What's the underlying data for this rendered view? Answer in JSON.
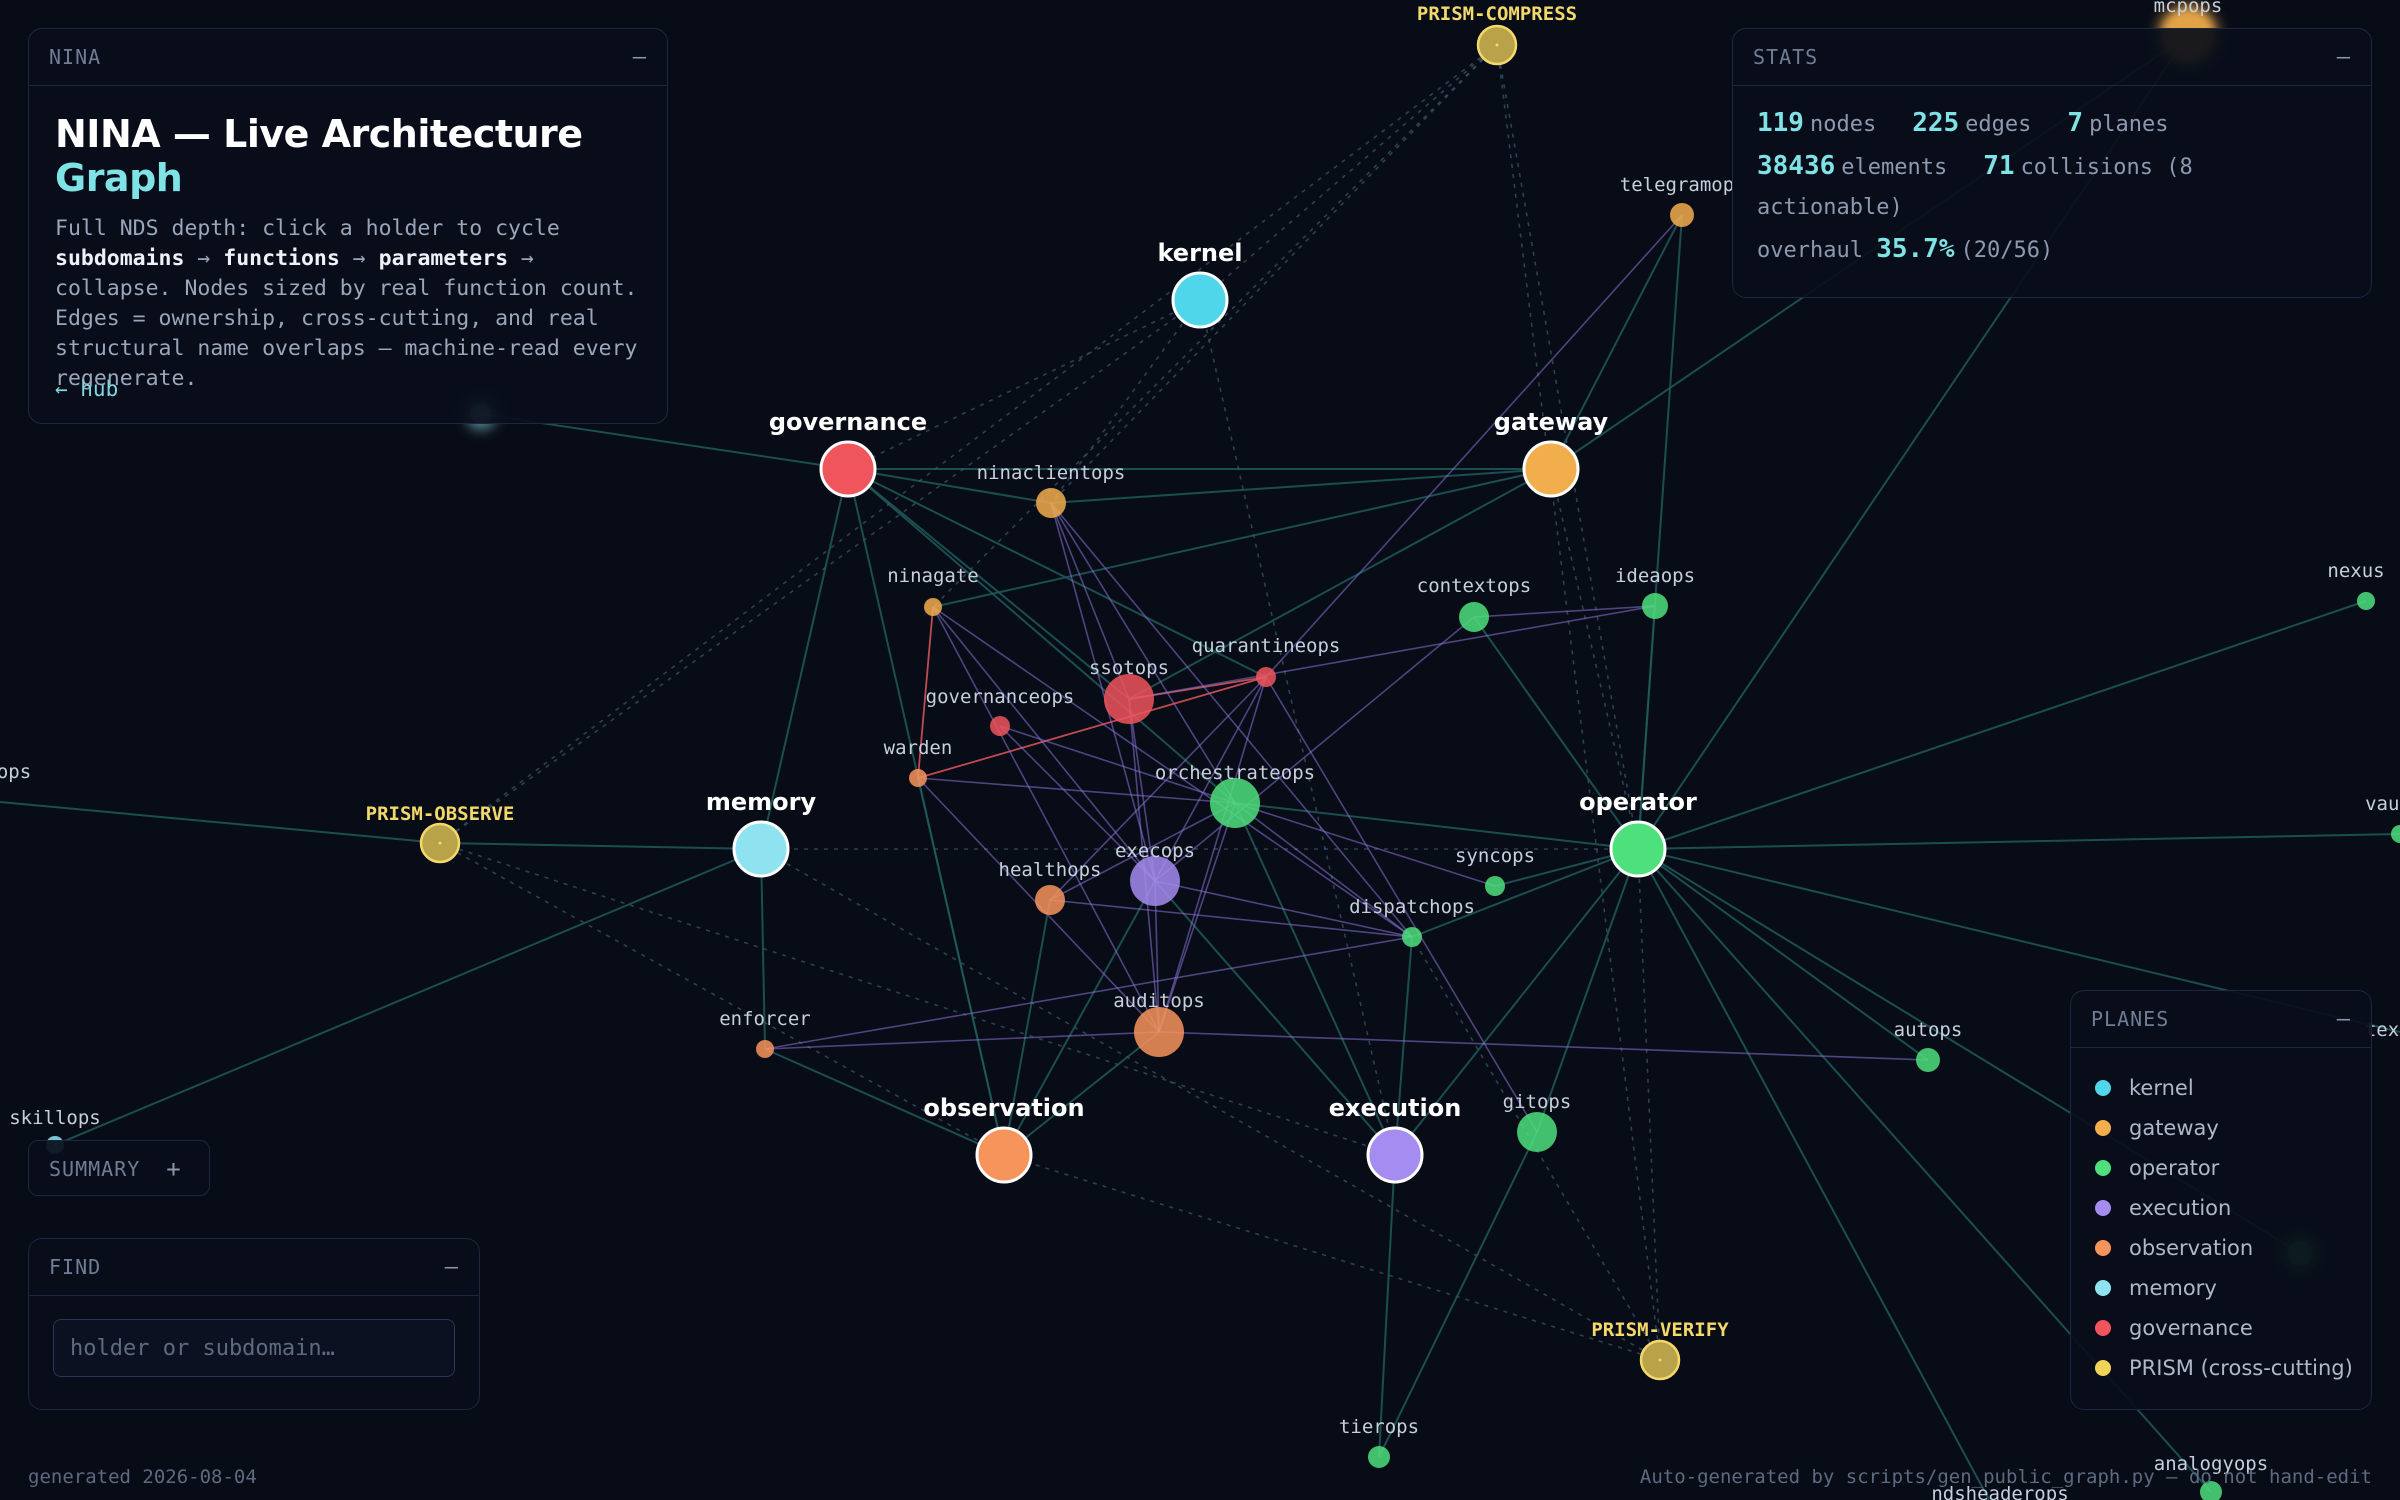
{
  "colors": {
    "background": "#080c16",
    "kernel": "#4fd6ea",
    "gateway": "#f2ad4c",
    "operator": "#4ee07c",
    "execution": "#a58cf0",
    "observation": "#f7945c",
    "memory": "#8fe3f0",
    "governance": "#f0555d",
    "prism": "#f0d45a",
    "edge_teal": "#1f5a5a",
    "edge_purple": "#8b72d8",
    "edge_red": "#e0565e"
  },
  "info_panel": {
    "header": "NINA",
    "title_main": "NINA — Live Architecture",
    "title_accent": "Graph",
    "desc_1": "Full NDS depth: click a holder to cycle",
    "desc_b1": "subdomains",
    "desc_arrow1": " → ",
    "desc_b2": "functions",
    "desc_arrow2": " → ",
    "desc_b3": "parameters",
    "desc_arrow3": " →",
    "desc_2": "collapse. Nodes sized by real function count. Edges = ownership, cross-cutting, and real structural name overlaps — machine-read every regenerate.",
    "hub_link": "← hub"
  },
  "stats_panel": {
    "header": "STATS",
    "nodes": "119",
    "nodes_label": "nodes",
    "edges": "225",
    "edges_label": "edges",
    "planes": "7",
    "planes_label": "planes",
    "elements": "38436",
    "elements_label": "elements",
    "collisions": "71",
    "collisions_label": "collisions (8 actionable)",
    "overhaul_label": "overhaul",
    "overhaul": "35.7%",
    "overhaul_ratio": "(20/56)"
  },
  "planes_panel": {
    "header": "PLANES",
    "items": [
      {
        "label": "kernel",
        "color": "#4fd6ea"
      },
      {
        "label": "gateway",
        "color": "#f2ad4c"
      },
      {
        "label": "operator",
        "color": "#4ee07c"
      },
      {
        "label": "execution",
        "color": "#a58cf0"
      },
      {
        "label": "observation",
        "color": "#f7945c"
      },
      {
        "label": "memory",
        "color": "#8fe3f0"
      },
      {
        "label": "governance",
        "color": "#f0555d"
      },
      {
        "label": "PRISM (cross-cutting)",
        "color": "#f0d45a"
      }
    ]
  },
  "summary_panel": {
    "header": "SUMMARY",
    "toggle": "+"
  },
  "find_panel": {
    "header": "FIND",
    "placeholder": "holder or subdomain…"
  },
  "footer": {
    "left": "generated 2026-08-04",
    "right": "Auto-generated by scripts/gen_public_graph.py — do not hand-edit"
  },
  "minimize_symbol": "–",
  "graph": {
    "nodes": [
      {
        "id": "kernel",
        "label": "kernel",
        "kind": "plane",
        "plane": "kernel"
      },
      {
        "id": "governance",
        "label": "governance",
        "kind": "plane",
        "plane": "governance"
      },
      {
        "id": "gateway",
        "label": "gateway",
        "kind": "plane",
        "plane": "gateway"
      },
      {
        "id": "memory",
        "label": "memory",
        "kind": "plane",
        "plane": "memory"
      },
      {
        "id": "operator",
        "label": "operator",
        "kind": "plane",
        "plane": "operator"
      },
      {
        "id": "observation",
        "label": "observation",
        "kind": "plane",
        "plane": "observation"
      },
      {
        "id": "execution",
        "label": "execution",
        "kind": "plane",
        "plane": "execution"
      },
      {
        "id": "prism-compress",
        "label": "PRISM-COMPRESS",
        "kind": "prism",
        "plane": "prism"
      },
      {
        "id": "prism-observe",
        "label": "PRISM-OBSERVE",
        "kind": "prism",
        "plane": "prism"
      },
      {
        "id": "prism-verify",
        "label": "PRISM-VERIFY",
        "kind": "prism",
        "plane": "prism"
      },
      {
        "id": "ninaclientops",
        "label": "ninaclientops",
        "kind": "holder",
        "plane": "gateway"
      },
      {
        "id": "ninagate",
        "label": "ninagate",
        "kind": "holder",
        "plane": "gateway"
      },
      {
        "id": "telegramops",
        "label": "telegramop",
        "kind": "holder",
        "plane": "gateway"
      },
      {
        "id": "mcpops",
        "label": "mcpops",
        "kind": "holder",
        "plane": "gateway"
      },
      {
        "id": "contextops",
        "label": "contextops",
        "kind": "holder",
        "plane": "operator"
      },
      {
        "id": "ideaops",
        "label": "ideaops",
        "kind": "holder",
        "plane": "operator"
      },
      {
        "id": "quarantineops",
        "label": "quarantineops",
        "kind": "holder",
        "plane": "governance"
      },
      {
        "id": "ssotops",
        "label": "ssotops",
        "kind": "holder",
        "plane": "governance"
      },
      {
        "id": "governanceops",
        "label": "governanceops",
        "kind": "holder",
        "plane": "governance"
      },
      {
        "id": "warden",
        "label": "warden",
        "kind": "holder",
        "plane": "observation"
      },
      {
        "id": "orchestrateops",
        "label": "orchestrateops",
        "kind": "holder",
        "plane": "operator"
      },
      {
        "id": "execops",
        "label": "execops",
        "kind": "holder",
        "plane": "execution"
      },
      {
        "id": "healthops",
        "label": "healthops",
        "kind": "holder",
        "plane": "observation"
      },
      {
        "id": "syncops",
        "label": "syncops",
        "kind": "holder",
        "plane": "operator"
      },
      {
        "id": "dispatchops",
        "label": "dispatchops",
        "kind": "holder",
        "plane": "operator"
      },
      {
        "id": "auditops",
        "label": "auditops",
        "kind": "holder",
        "plane": "observation"
      },
      {
        "id": "enforcer",
        "label": "enforcer",
        "kind": "holder",
        "plane": "observation"
      },
      {
        "id": "autops",
        "label": "autops",
        "kind": "holder",
        "plane": "operator"
      },
      {
        "id": "gitops",
        "label": "gitops",
        "kind": "holder",
        "plane": "operator"
      },
      {
        "id": "tierops",
        "label": "tierops",
        "kind": "holder",
        "plane": "operator"
      },
      {
        "id": "nexus",
        "label": "nexus",
        "kind": "holder",
        "plane": "operator"
      },
      {
        "id": "vault",
        "label": "vaul",
        "kind": "holder",
        "plane": "operator"
      },
      {
        "id": "skillops",
        "label": "skillops",
        "kind": "holder",
        "plane": "memory"
      },
      {
        "id": "ops-left",
        "label": "ops",
        "kind": "holder",
        "plane": "operator"
      },
      {
        "id": "analogyops",
        "label": "analogyops",
        "kind": "holder",
        "plane": "operator"
      },
      {
        "id": "ndsheaderops",
        "label": "ndsheaderops",
        "kind": "holder",
        "plane": "operator"
      },
      {
        "id": "contex-right",
        "label": "tex",
        "kind": "holder",
        "plane": "operator"
      },
      {
        "id": "blurred-memory",
        "label": "",
        "kind": "holder",
        "plane": "memory"
      },
      {
        "id": "blurred-operator",
        "label": "",
        "kind": "holder",
        "plane": "operator"
      }
    ],
    "edges": [
      {
        "from": "governance",
        "to": "ninaclientops",
        "style": "teal"
      },
      {
        "from": "governance",
        "to": "gateway",
        "style": "teal"
      },
      {
        "from": "governance",
        "to": "ssotops",
        "style": "teal"
      },
      {
        "from": "governance",
        "to": "observation",
        "style": "teal"
      },
      {
        "from": "governance",
        "to": "memory",
        "style": "teal"
      },
      {
        "from": "governance",
        "to": "blurred-memory",
        "style": "teal"
      },
      {
        "from": "governance",
        "to": "orchestrateops",
        "style": "teal"
      },
      {
        "from": "governance",
        "to": "quarantineops",
        "style": "teal"
      },
      {
        "from": "kernel",
        "to": "governance",
        "style": "dash"
      },
      {
        "from": "kernel",
        "to": "prism-observe",
        "style": "dash"
      },
      {
        "from": "kernel",
        "to": "execution",
        "style": "dash"
      },
      {
        "from": "kernel",
        "to": "ninaclientops",
        "style": "dash"
      },
      {
        "from": "gateway",
        "to": "ninaclientops",
        "style": "teal"
      },
      {
        "from": "gateway",
        "to": "ninagate",
        "style": "teal"
      },
      {
        "from": "gateway",
        "to": "telegramops",
        "style": "teal"
      },
      {
        "from": "gateway",
        "to": "mcpops",
        "style": "teal"
      },
      {
        "from": "gateway",
        "to": "operator",
        "style": "dash"
      },
      {
        "from": "gateway",
        "to": "ssotops",
        "style": "teal"
      },
      {
        "from": "operator",
        "to": "contextops",
        "style": "teal"
      },
      {
        "from": "operator",
        "to": "ideaops",
        "style": "teal"
      },
      {
        "from": "operator",
        "to": "nexus",
        "style": "teal"
      },
      {
        "from": "operator",
        "to": "vault",
        "style": "teal"
      },
      {
        "from": "operator",
        "to": "orchestrateops",
        "style": "teal"
      },
      {
        "from": "operator",
        "to": "syncops",
        "style": "teal"
      },
      {
        "from": "operator",
        "to": "dispatchops",
        "style": "teal"
      },
      {
        "from": "operator",
        "to": "autops",
        "style": "teal"
      },
      {
        "from": "operator",
        "to": "gitops",
        "style": "teal"
      },
      {
        "from": "operator",
        "to": "execution",
        "style": "teal"
      },
      {
        "from": "operator",
        "to": "blurred-operator",
        "style": "teal"
      },
      {
        "from": "operator",
        "to": "contex-right",
        "style": "teal"
      },
      {
        "from": "operator",
        "to": "analogyops",
        "style": "teal"
      },
      {
        "from": "operator",
        "to": "ndsheaderops",
        "style": "teal"
      },
      {
        "from": "operator",
        "to": "telegramops",
        "style": "teal"
      },
      {
        "from": "operator",
        "to": "mcpops",
        "style": "teal"
      },
      {
        "from": "operator",
        "to": "memory",
        "style": "dash"
      },
      {
        "from": "operator",
        "to": "prism-verify",
        "style": "dash"
      },
      {
        "from": "memory",
        "to": "prism-observe",
        "style": "teal"
      },
      {
        "from": "memory",
        "to": "skillops",
        "style": "teal"
      },
      {
        "from": "memory",
        "to": "enforcer",
        "style": "teal"
      },
      {
        "from": "prism-observe",
        "to": "ops-left",
        "style": "teal"
      },
      {
        "from": "prism-observe",
        "to": "prism-compress",
        "style": "dash"
      },
      {
        "from": "prism-observe",
        "to": "observation",
        "style": "dash"
      },
      {
        "from": "prism-observe",
        "to": "execution",
        "style": "dash"
      },
      {
        "from": "prism-compress",
        "to": "operator",
        "style": "dash"
      },
      {
        "from": "prism-compress",
        "to": "prism-verify",
        "style": "dash"
      },
      {
        "from": "prism-compress",
        "to": "kernel",
        "style": "dash"
      },
      {
        "from": "prism-compress",
        "to": "ninaclientops",
        "style": "dash"
      },
      {
        "from": "prism-compress",
        "to": "ninagate",
        "style": "dash"
      },
      {
        "from": "prism-verify",
        "to": "observation",
        "style": "dash"
      },
      {
        "from": "prism-verify",
        "to": "memory",
        "style": "dash"
      },
      {
        "from": "prism-verify",
        "to": "dispatchops",
        "style": "dash"
      },
      {
        "from": "observation",
        "to": "auditops",
        "style": "teal"
      },
      {
        "from": "observation",
        "to": "healthops",
        "style": "teal"
      },
      {
        "from": "observation",
        "to": "enforcer",
        "style": "teal"
      },
      {
        "from": "observation",
        "to": "warden",
        "style": "teal"
      },
      {
        "from": "observation",
        "to": "execops",
        "style": "teal"
      },
      {
        "from": "execution",
        "to": "execops",
        "style": "teal"
      },
      {
        "from": "execution",
        "to": "dispatchops",
        "style": "teal"
      },
      {
        "from": "execution",
        "to": "tierops",
        "style": "teal"
      },
      {
        "from": "execution",
        "to": "orchestrateops",
        "style": "teal"
      },
      {
        "from": "tierops",
        "to": "gitops",
        "style": "teal"
      },
      {
        "from": "ninagate",
        "to": "warden",
        "style": "red"
      },
      {
        "from": "warden",
        "to": "quarantineops",
        "style": "red"
      },
      {
        "from": "ssotops",
        "to": "quarantineops",
        "style": "red"
      },
      {
        "from": "ninaclientops",
        "to": "ssotops",
        "style": "purple"
      },
      {
        "from": "ninaclientops",
        "to": "execops",
        "style": "purple"
      },
      {
        "from": "ninaclientops",
        "to": "orchestrateops",
        "style": "purple"
      },
      {
        "from": "quarantineops",
        "to": "execops",
        "style": "purple"
      },
      {
        "from": "quarantineops",
        "to": "healthops",
        "style": "purple"
      },
      {
        "from": "quarantineops",
        "to": "gitops",
        "style": "purple"
      },
      {
        "from": "quarantineops",
        "to": "auditops",
        "style": "purple"
      },
      {
        "from": "contextops",
        "to": "execops",
        "style": "purple"
      },
      {
        "from": "contextops",
        "to": "ideaops",
        "style": "purple"
      },
      {
        "from": "ideaops",
        "to": "ssotops",
        "style": "purple"
      },
      {
        "from": "ninagate",
        "to": "execops",
        "style": "purple"
      },
      {
        "from": "ninagate",
        "to": "auditops",
        "style": "purple"
      },
      {
        "from": "ninagate",
        "to": "dispatchops",
        "style": "purple"
      },
      {
        "from": "governanceops",
        "to": "orchestrateops",
        "style": "purple"
      },
      {
        "from": "governanceops",
        "to": "execops",
        "style": "purple"
      },
      {
        "from": "warden",
        "to": "orchestrateops",
        "style": "purple"
      },
      {
        "from": "warden",
        "to": "auditops",
        "style": "purple"
      },
      {
        "from": "healthops",
        "to": "orchestrateops",
        "style": "purple"
      },
      {
        "from": "healthops",
        "to": "dispatchops",
        "style": "purple"
      },
      {
        "from": "execops",
        "to": "dispatchops",
        "style": "purple"
      },
      {
        "from": "execops",
        "to": "auditops",
        "style": "purple"
      },
      {
        "from": "orchestrateops",
        "to": "auditops",
        "style": "purple"
      },
      {
        "from": "orchestrateops",
        "to": "dispatchops",
        "style": "purple"
      },
      {
        "from": "enforcer",
        "to": "auditops",
        "style": "purple"
      },
      {
        "from": "enforcer",
        "to": "dispatchops",
        "style": "purple"
      },
      {
        "from": "auditops",
        "to": "autops",
        "style": "purple"
      },
      {
        "from": "ssotops",
        "to": "execops",
        "style": "purple"
      },
      {
        "from": "ssotops",
        "to": "auditops",
        "style": "purple"
      },
      {
        "from": "syncops",
        "to": "orchestrateops",
        "style": "purple"
      },
      {
        "from": "telegramops",
        "to": "quarantineops",
        "style": "purple"
      },
      {
        "from": "ninaclientops",
        "to": "dispatchops",
        "style": "purple"
      }
    ]
  }
}
